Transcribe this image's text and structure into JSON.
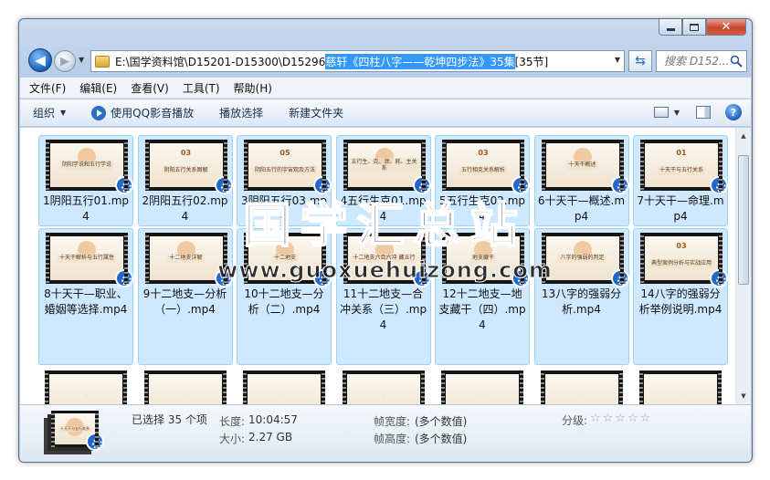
{
  "window": {
    "close_glyph": "✕"
  },
  "nav": {
    "back_glyph": "◀",
    "forward_glyph": "▶",
    "address_prefix": "E:\\国学资料馆\\D15201-D15300\\D15296 ",
    "address_selected": "慈轩《四柱八字——乾坤四步法》35集",
    "address_tail": "[35节]",
    "refresh_glyph": "⇆",
    "search_placeholder": "搜索 D152..."
  },
  "menu": {
    "items": [
      "文件(F)",
      "编辑(E)",
      "查看(V)",
      "工具(T)",
      "帮助(H)"
    ]
  },
  "toolbar": {
    "organize": "组织",
    "qq_play": "使用QQ影音播放",
    "play_selection": "播放选择",
    "new_folder": "新建文件夹",
    "help": "?"
  },
  "files": [
    {
      "name": "1阴阳五行01.mp4",
      "slide_title": "阴阳学说和五行学说",
      "slide_num": ""
    },
    {
      "name": "2阴阳五行02.mp4",
      "slide_title": "阴阳五行关系图解",
      "slide_num": "03"
    },
    {
      "name": "3阴阳五行03.mp4",
      "slide_title": "阴阳五行的宇宙观及方法",
      "slide_num": "05"
    },
    {
      "name": "4五行生克01.mp4",
      "slide_title": "五行生、克、泄、耗、主关系",
      "slide_num": ""
    },
    {
      "name": "5五行生克02.mp4",
      "slide_title": "五行相克关系解析",
      "slide_num": "03"
    },
    {
      "name": "6十天干—概述.mp4",
      "slide_title": "十天干概述",
      "slide_num": ""
    },
    {
      "name": "7十天干—命理.mp4",
      "slide_title": "十天干与五行关系",
      "slide_num": "01"
    },
    {
      "name": "8十天干—职业、婚姻等选择.mp4",
      "slide_title": "十天干解析与五行属性",
      "slide_num": ""
    },
    {
      "name": "9十二地支—分析（一）.mp4",
      "slide_title": "十二地支详解",
      "slide_num": ""
    },
    {
      "name": "10十二地支—分析（二）.mp4",
      "slide_title": "十二地支",
      "slide_num": ""
    },
    {
      "name": "11十二地支—合冲关系（三）.mp4",
      "slide_title": "十二地支六合六冲 藏五行",
      "slide_num": ""
    },
    {
      "name": "12十二地支—地支藏干（四）.mp4",
      "slide_title": "地支藏干",
      "slide_num": ""
    },
    {
      "name": "13八字的强弱分析.mp4",
      "slide_title": "八字的强弱的判定",
      "slide_num": ""
    },
    {
      "name": "14八字的强弱分析举例说明.mp4",
      "slide_title": "典型案例分析与实战应用",
      "slide_num": "03"
    },
    {
      "name": "",
      "slide_title": "",
      "slide_num": ""
    },
    {
      "name": "",
      "slide_title": "",
      "slide_num": ""
    },
    {
      "name": "",
      "slide_title": "",
      "slide_num": ""
    },
    {
      "name": "",
      "slide_title": "",
      "slide_num": ""
    },
    {
      "name": "",
      "slide_title": "",
      "slide_num": ""
    },
    {
      "name": "",
      "slide_title": "",
      "slide_num": ""
    },
    {
      "name": "",
      "slide_title": "",
      "slide_num": ""
    }
  ],
  "watermark": {
    "title": "国学汇总站",
    "url": "www.guoxuehuizong.com"
  },
  "details": {
    "selected": "已选择 35 个项",
    "length_label": "长度:",
    "length_value": "10:04:57",
    "size_label": "大小:",
    "size_value": "2.27 GB",
    "frame_width_label": "帧宽度:",
    "frame_width_value": "(多个数值)",
    "frame_height_label": "帧高度:",
    "frame_height_value": "(多个数值)",
    "rating_label": "分级:",
    "rating_stars": "☆☆☆☆☆",
    "preview_title": "十天干与五行关系"
  }
}
